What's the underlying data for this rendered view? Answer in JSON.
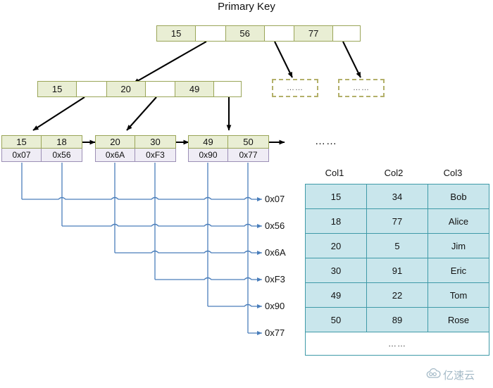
{
  "title": "Primary Key",
  "colors": {
    "node_border": "#9aa558",
    "node_key_fill": "#e9eed4",
    "node_ptr_fill": "#ffffff",
    "addr_border": "#9c8fb5",
    "addr_fill": "#efecf5",
    "link_line": "#4a7ebb",
    "tree_arrow": "#000000",
    "table_border": "#3f9aa8",
    "table_fill": "#c9e6ec",
    "dashbox_border": "#b3b06a"
  },
  "tree": {
    "root": {
      "cells": [
        {
          "text": "15",
          "type": "key"
        },
        {
          "text": "",
          "type": "ptr"
        },
        {
          "text": "56",
          "type": "key"
        },
        {
          "text": "",
          "type": "ptr"
        },
        {
          "text": "77",
          "type": "key"
        },
        {
          "text": "",
          "type": "ptr"
        }
      ]
    },
    "internal": {
      "cells": [
        {
          "text": "15",
          "type": "key"
        },
        {
          "text": "",
          "type": "ptr"
        },
        {
          "text": "20",
          "type": "key"
        },
        {
          "text": "",
          "type": "ptr"
        },
        {
          "text": "49",
          "type": "key"
        },
        {
          "text": "",
          "type": "ptr"
        }
      ]
    },
    "placeholders": [
      {
        "text": "……"
      },
      {
        "text": "……"
      }
    ],
    "leaves": [
      {
        "keys": [
          "15",
          "18"
        ],
        "addrs": [
          "0x07",
          "0x56"
        ]
      },
      {
        "keys": [
          "20",
          "30"
        ],
        "addrs": [
          "0x6A",
          "0xF3"
        ]
      },
      {
        "keys": [
          "49",
          "50"
        ],
        "addrs": [
          "0x90",
          "0x77"
        ]
      }
    ]
  },
  "address_labels": [
    "0x07",
    "0x56",
    "0x6A",
    "0xF3",
    "0x90",
    "0x77"
  ],
  "table_ellipsis_top": "……",
  "table": {
    "headers": [
      "Col1",
      "Col2",
      "Col3"
    ],
    "rows": [
      [
        "15",
        "34",
        "Bob"
      ],
      [
        "18",
        "77",
        "Alice"
      ],
      [
        "20",
        "5",
        "Jim"
      ],
      [
        "30",
        "91",
        "Eric"
      ],
      [
        "49",
        "22",
        "Tom"
      ],
      [
        "50",
        "89",
        "Rose"
      ]
    ],
    "more_row": "……"
  },
  "watermark": {
    "text": "亿速云"
  }
}
